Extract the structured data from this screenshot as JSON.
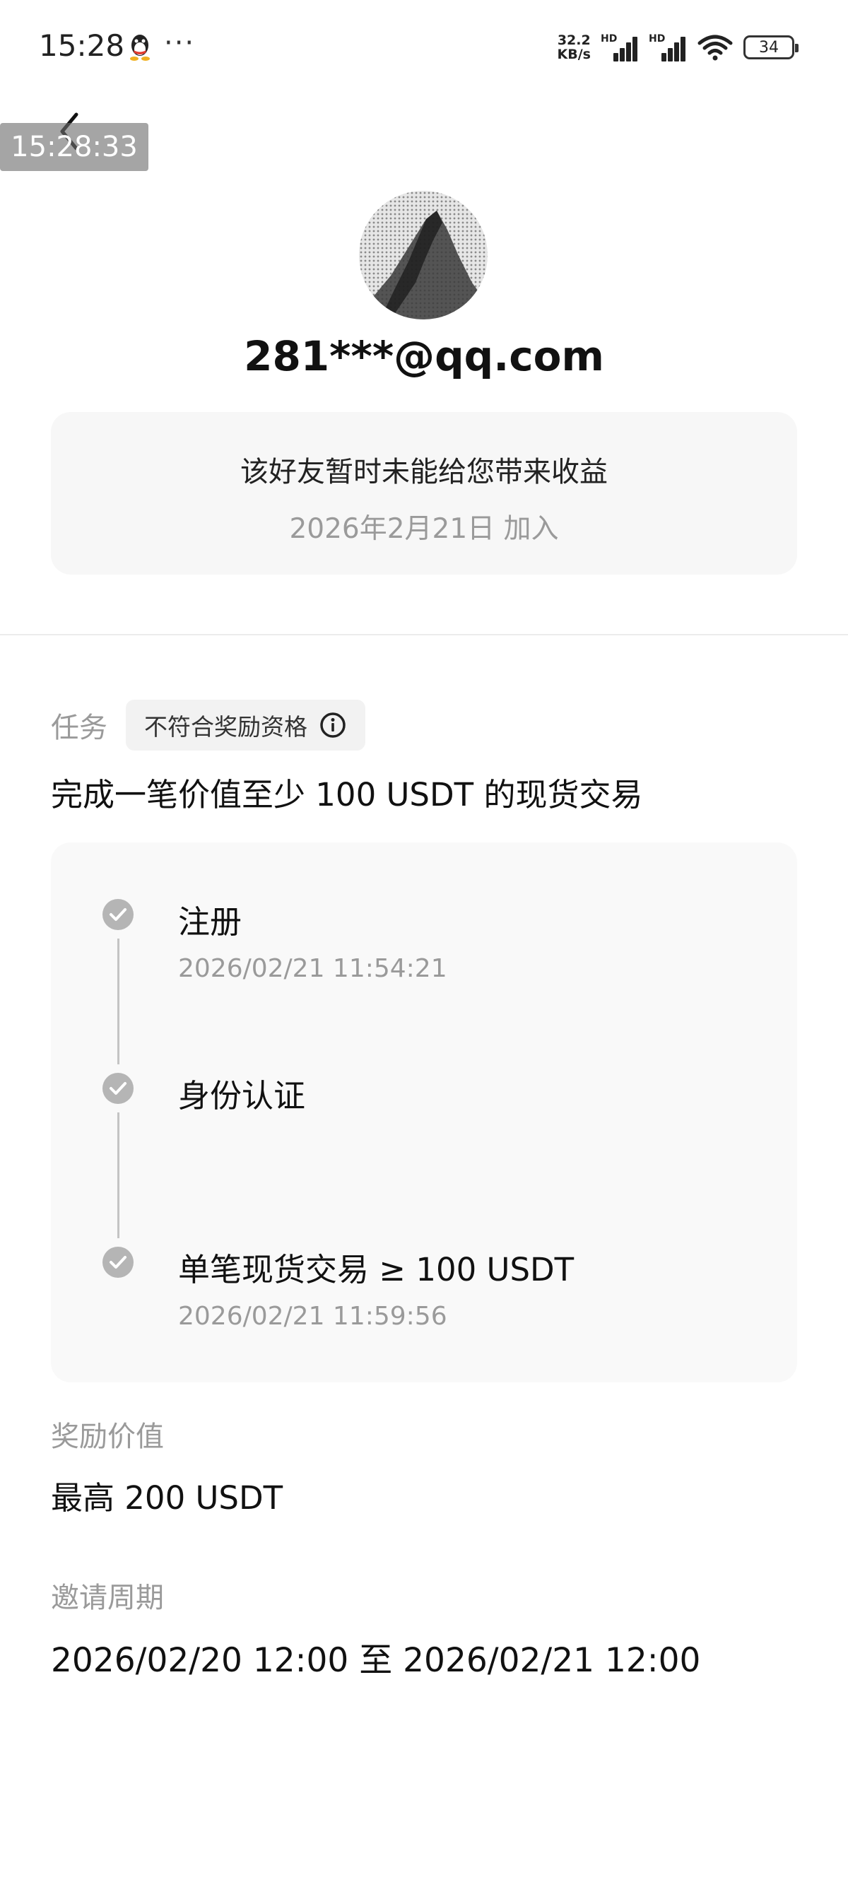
{
  "status_bar": {
    "time": "15:28",
    "net_speed_value": "32.2",
    "net_speed_unit": "KB/s",
    "signal_label": "HD",
    "battery": "34",
    "icons": [
      "qq-icon",
      "more-icon",
      "signal-icon",
      "wifi-icon",
      "battery-icon"
    ]
  },
  "header": {
    "overlay_time": "15:28:33"
  },
  "profile": {
    "email": "281***@qq.com"
  },
  "info_card": {
    "message": "该好友暂时未能给您带来收益",
    "joined": "2026年2月21日 加入"
  },
  "task": {
    "label": "任务",
    "badge": "不符合奖励资格",
    "description": "完成一笔价值至少 100 USDT 的现货交易"
  },
  "steps": [
    {
      "title": "注册",
      "time": "2026/02/21 11:54:21"
    },
    {
      "title": "身份认证",
      "time": ""
    },
    {
      "title": "单笔现货交易 ≥ 100 USDT",
      "time": "2026/02/21 11:59:56"
    }
  ],
  "reward": {
    "label": "奖励价值",
    "value": "最高 200 USDT"
  },
  "period": {
    "label": "邀请周期",
    "value": "2026/02/20 12:00 至 2026/02/21 12:00"
  },
  "colors": {
    "muted_text": "#9a9a9a",
    "card_background": "#f7f7f7",
    "check_gray": "#b5b5b5"
  }
}
